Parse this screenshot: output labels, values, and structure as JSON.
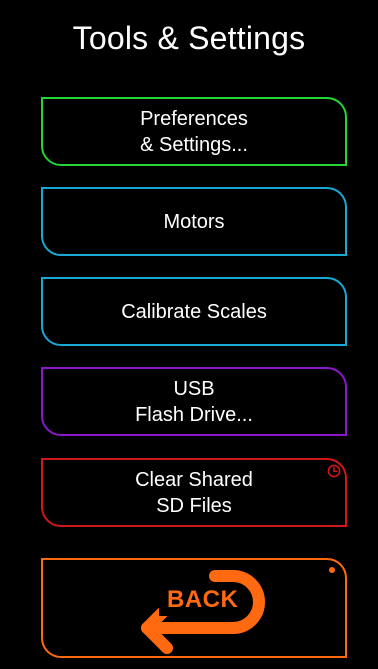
{
  "screen": {
    "title": "Tools & Settings"
  },
  "buttons": {
    "preferences": {
      "line1": "Preferences",
      "line2": "& Settings...",
      "color": "#22d633"
    },
    "motors": {
      "line1": "Motors",
      "color": "#19a7d4"
    },
    "calibrate": {
      "line1": "Calibrate Scales",
      "color": "#19a7d4"
    },
    "usb": {
      "line1": "USB",
      "line2": "Flash Drive...",
      "color": "#8a18c9"
    },
    "clear_sd": {
      "line1": "Clear Shared",
      "line2": "SD Files",
      "color": "#d01818",
      "badge_icon": "clock-icon"
    },
    "back": {
      "label": "BACK",
      "color": "#ff6a10",
      "icon": "u-turn-arrow-icon"
    }
  }
}
